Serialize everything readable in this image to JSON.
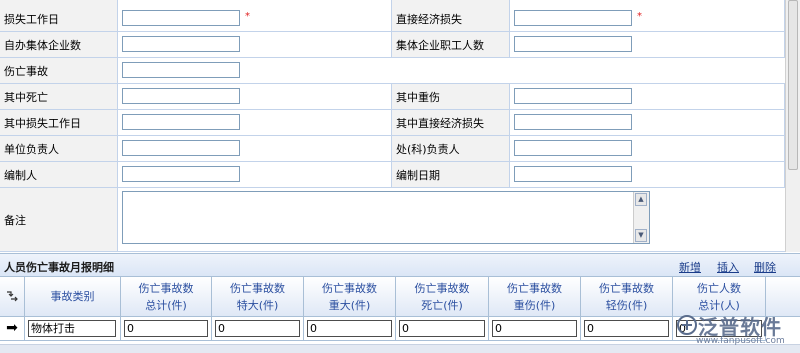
{
  "form": {
    "row1": {
      "label_left": "损失工作日",
      "label_right": "直接经济损失",
      "required_mark": "*"
    },
    "row2": {
      "label_left": "自办集体企业数",
      "label_right": "集体企业职工人数"
    },
    "row3": {
      "label_left": "伤亡事故"
    },
    "row4": {
      "label_left": "其中死亡",
      "label_right": "其中重伤"
    },
    "row5": {
      "label_left": "其中损失工作日",
      "label_right": "其中直接经济损失"
    },
    "row6": {
      "label_left": "单位负责人",
      "label_right": "处(科)负责人"
    },
    "row7": {
      "label_left": "编制人",
      "label_right": "编制日期"
    },
    "notes": {
      "label": "备注"
    }
  },
  "detail": {
    "title": "人员伤亡事故月报明细",
    "actions": {
      "add": "新增",
      "insert": "插入",
      "delete": "删除"
    },
    "columns": [
      {
        "line1": "事故类别",
        "line2": ""
      },
      {
        "line1": "伤亡事故数",
        "line2": "总计(件)"
      },
      {
        "line1": "伤亡事故数",
        "line2": "特大(件)"
      },
      {
        "line1": "伤亡事故数",
        "line2": "重大(件)"
      },
      {
        "line1": "伤亡事故数",
        "line2": "死亡(件)"
      },
      {
        "line1": "伤亡事故数",
        "line2": "重伤(件)"
      },
      {
        "line1": "伤亡事故数",
        "line2": "轻伤(件)"
      },
      {
        "line1": "伤亡人数",
        "line2": "总计(人)"
      }
    ],
    "row": {
      "marker": "➡",
      "category": "物体打击",
      "values": [
        "0",
        "0",
        "0",
        "0",
        "0",
        "0",
        "0"
      ]
    }
  },
  "watermark": {
    "brand": "泛普软件",
    "url": "www.fanpusoft.com"
  },
  "icons": {
    "header_corner": "expand-collapse-icon",
    "row_marker": "current-row-arrow-icon"
  },
  "colors": {
    "required": "#e02020",
    "header_text": "#2b4fa0",
    "link": "#1a3c8a",
    "border": "#a9bfd6"
  }
}
